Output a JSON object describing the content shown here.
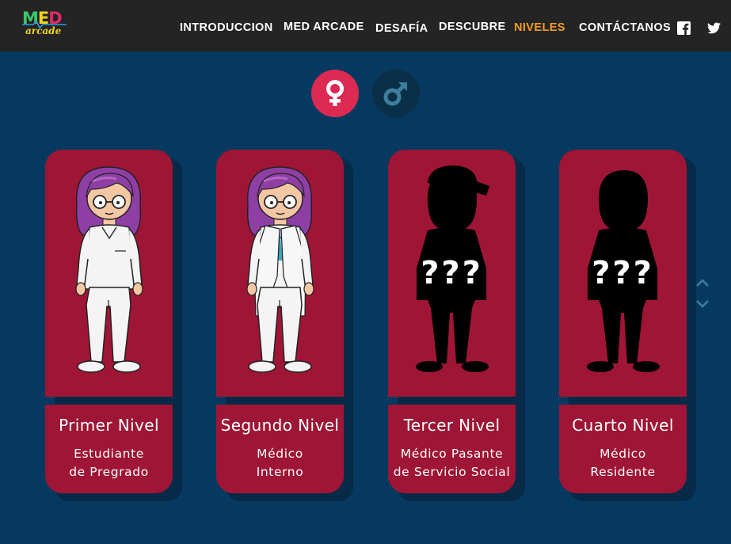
{
  "logo": {
    "top_letters": [
      "M",
      "E",
      "D"
    ],
    "sub": "arcade"
  },
  "nav": {
    "items": [
      {
        "label": "INTRODUCCION",
        "active": false
      },
      {
        "label": "MED ARCADE",
        "active": false
      },
      {
        "label": "DESAFÍA",
        "active": false
      },
      {
        "label": "DESCUBRE",
        "active": false
      },
      {
        "label": "NIVELES",
        "active": true
      },
      {
        "label": "CONTÁCTANOS",
        "active": false
      }
    ],
    "social": [
      "facebook-icon",
      "twitter-icon"
    ]
  },
  "gender": {
    "selected": "female",
    "options": [
      "female",
      "male"
    ]
  },
  "levels": [
    {
      "title": "Primer Nivel",
      "subtitle": [
        "Estudiante",
        "de Pregrado"
      ],
      "unlocked": true,
      "mystery": ""
    },
    {
      "title": "Segundo Nivel",
      "subtitle": [
        "Médico",
        "Interno"
      ],
      "unlocked": true,
      "mystery": ""
    },
    {
      "title": "Tercer Nivel",
      "subtitle": [
        "Médico Pasante",
        "de Servicio Social"
      ],
      "unlocked": false,
      "mystery": "???"
    },
    {
      "title": "Cuarto Nivel",
      "subtitle": [
        "Médico",
        "Residente"
      ],
      "unlocked": false,
      "mystery": "???"
    }
  ],
  "colors": {
    "background": "#06395f",
    "navbar": "#242424",
    "card": "#9f1535",
    "active_nav": "#f39a21",
    "female_toggle": "#dd2a52",
    "male_toggle": "#0a2f48"
  }
}
